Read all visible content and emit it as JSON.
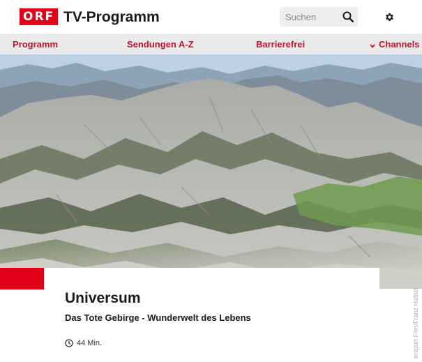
{
  "header": {
    "logo_text": "ORF",
    "title": "TV-Programm",
    "search": {
      "label": "Suchen",
      "icon": "search-icon"
    },
    "settings_icon": "gear-icon",
    "brand_color": "#e2001a"
  },
  "nav": {
    "items": [
      {
        "label": "Programm"
      },
      {
        "label": "Sendungen A-Z"
      },
      {
        "label": "Barrierefrei"
      },
      {
        "label": "Channels",
        "icon": "chevron-down-icon"
      }
    ],
    "text_color": "#c8102e",
    "background": "#eaeaea"
  },
  "hero": {
    "image": "mountain-landscape",
    "credit": "ersport Film/Franz Hafner"
  },
  "program": {
    "title": "Universum",
    "subtitle": "Das Tote Gebirge - Wunderwelt des Lebens",
    "duration": "44 Min.",
    "duration_icon": "clock-icon"
  }
}
